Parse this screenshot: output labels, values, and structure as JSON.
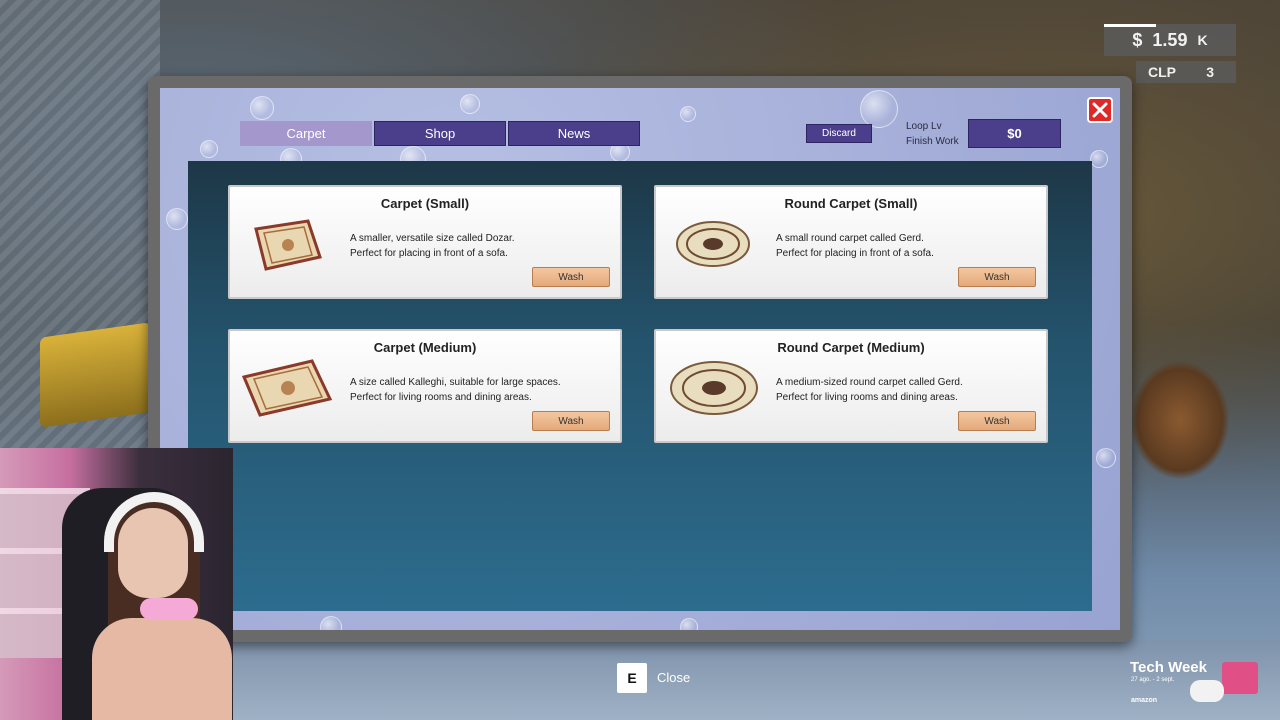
{
  "hud": {
    "money_symbol": "$",
    "money_value": "1.59",
    "money_unit": "K",
    "clp_label": "CLP",
    "clp_value": "3"
  },
  "tabs": [
    {
      "label": "Carpet",
      "active": true
    },
    {
      "label": "Shop",
      "active": false
    },
    {
      "label": "News",
      "active": false
    }
  ],
  "header": {
    "discard_label": "Discard",
    "loop_lv_label": "Loop Lv",
    "finish_work_label": "Finish Work",
    "finish_value": "$0"
  },
  "cards": [
    {
      "title": "Carpet (Small)",
      "desc_line1": "A smaller, versatile size called Dozar.",
      "desc_line2": "Perfect for placing in front of a sofa.",
      "button": "Wash",
      "icon": "rectangular-carpet-icon"
    },
    {
      "title": "Round Carpet (Small)",
      "desc_line1": "A small round carpet called Gerd.",
      "desc_line2": "Perfect for placing in front of a sofa.",
      "button": "Wash",
      "icon": "round-carpet-icon"
    },
    {
      "title": "Carpet (Medium)",
      "desc_line1": "A size called Kalleghi, suitable for large spaces.",
      "desc_line2": "Perfect for living rooms and dining areas.",
      "button": "Wash",
      "icon": "rectangular-carpet-icon"
    },
    {
      "title": "Round Carpet (Medium)",
      "desc_line1": "A medium-sized round carpet called Gerd.",
      "desc_line2": "Perfect for living rooms and dining areas.",
      "button": "Wash",
      "icon": "round-carpet-icon"
    }
  ],
  "prompt": {
    "key": "E",
    "label": "Close"
  },
  "techweek": {
    "title": "Tech Week",
    "dates": "27 ago. - 2 sept.",
    "brand": "amazon"
  },
  "colors": {
    "accent": "#4b3f8c",
    "active_tab": "#a397cc",
    "close": "#e02828",
    "wash": "#e3a97b"
  }
}
